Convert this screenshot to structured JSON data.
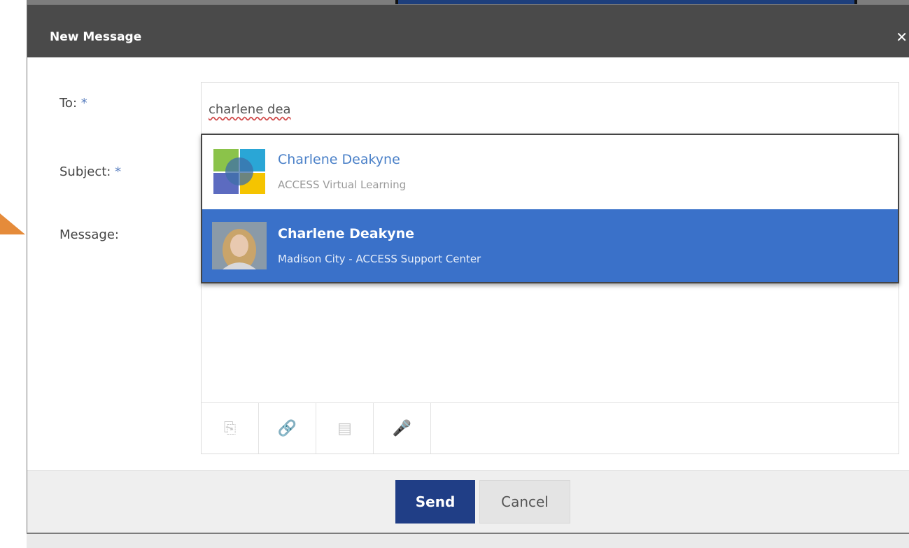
{
  "dialog": {
    "title": "New Message",
    "close_icon": "close-icon"
  },
  "form": {
    "to_label": "To:",
    "subject_label": "Subject:",
    "message_label": "Message:",
    "required_mark": "*",
    "to_value": "charlene dea"
  },
  "suggestions": [
    {
      "name": "Charlene Deakyne",
      "org": "ACCESS Virtual Learning",
      "avatar": "access-logo",
      "selected": false
    },
    {
      "name": "Charlene Deakyne",
      "org": "Madison City - ACCESS Support Center",
      "avatar": "user-photo",
      "selected": true
    }
  ],
  "toolbar": {
    "icons": [
      "insert-icon",
      "link-icon",
      "document-icon",
      "microphone-icon"
    ]
  },
  "footer": {
    "send_label": "Send",
    "cancel_label": "Cancel"
  },
  "colors": {
    "header": "#4a4a4a",
    "selected": "#3a71c9",
    "send": "#203e86",
    "link": "#4a80c8"
  }
}
